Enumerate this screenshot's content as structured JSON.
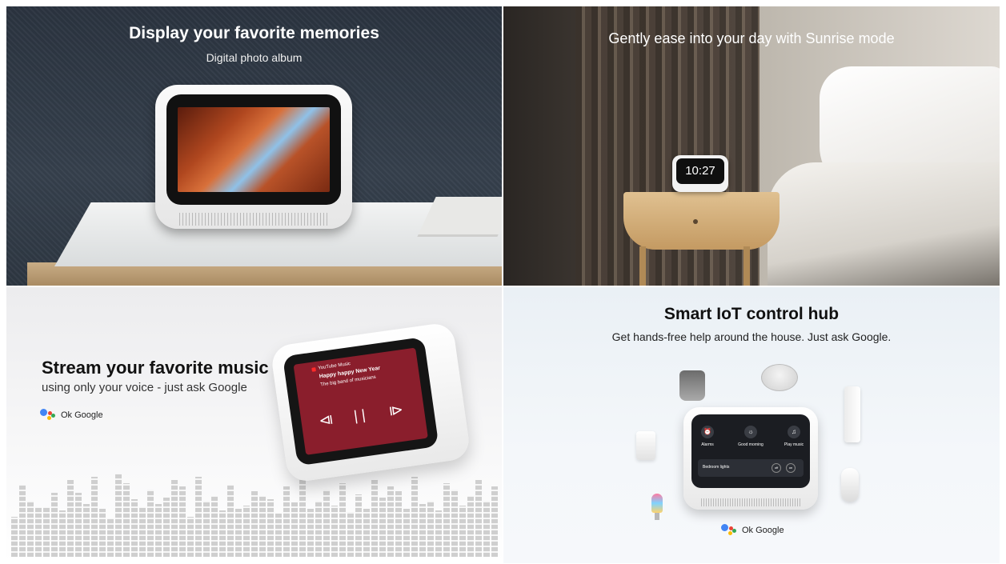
{
  "panels": {
    "memories": {
      "title": "Display your favorite memories",
      "subtitle": "Digital photo album"
    },
    "sunrise": {
      "title": "Gently ease into your day with Sunrise mode",
      "clock_time": "10:27"
    },
    "music": {
      "title": "Stream your favorite music",
      "subtitle": "using only your voice - just ask Google",
      "ok_google": "Ok Google",
      "screen": {
        "app": "YouTube Music",
        "song": "Happy happy New Year",
        "artist": "The big band of musicians"
      }
    },
    "iot": {
      "title": "Smart IoT control hub",
      "subtitle": "Get hands-free help around the house. Just ask Google.",
      "ok_google": "Ok Google",
      "screen": {
        "items": [
          "Alarms",
          "Good morning",
          "Play music"
        ],
        "row_label": "Bedroom lights",
        "off_label": "off",
        "on_label": "on"
      }
    }
  },
  "icons": {
    "google_assistant": "google-assistant-icon",
    "prev": "skip-previous-icon",
    "pause": "pause-icon",
    "next": "skip-next-icon"
  },
  "colors": {
    "music_screen": "#8a1e2c",
    "google_blue": "#4285f4",
    "google_red": "#ea4335",
    "google_yellow": "#fbbc05",
    "google_green": "#34a853"
  }
}
